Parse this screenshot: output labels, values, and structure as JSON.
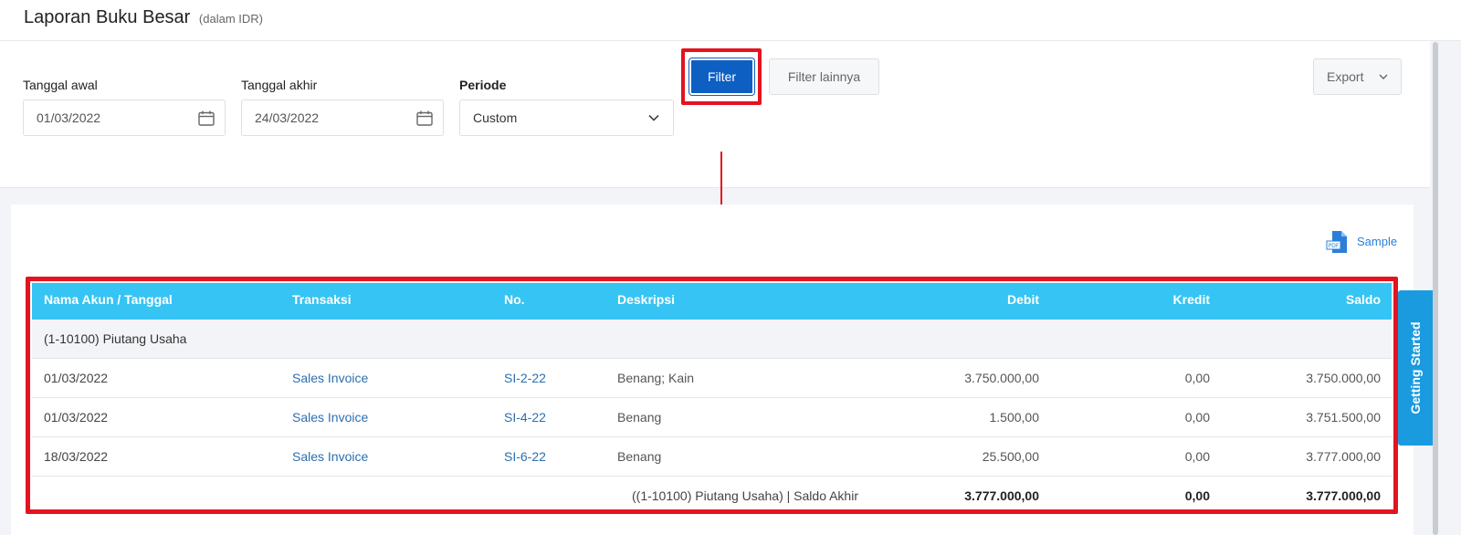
{
  "header": {
    "title": "Laporan Buku Besar",
    "subtitle": "(dalam IDR)"
  },
  "filters": {
    "start_label": "Tanggal awal",
    "start_value": "01/03/2022",
    "end_label": "Tanggal akhir",
    "end_value": "24/03/2022",
    "period_label": "Periode",
    "period_value": "Custom",
    "filter_button": "Filter",
    "more_filters_button": "Filter lainnya",
    "export_button": "Export"
  },
  "sample_link": "Sample",
  "table": {
    "columns": [
      "Nama Akun / Tanggal",
      "Transaksi",
      "No.",
      "Deskripsi",
      "Debit",
      "Kredit",
      "Saldo"
    ],
    "group": "(1-10100) Piutang Usaha",
    "rows": [
      {
        "date": "01/03/2022",
        "transaction": "Sales Invoice",
        "number": "SI-2-22",
        "description": "Benang; Kain",
        "debit": "3.750.000,00",
        "credit": "0,00",
        "balance": "3.750.000,00"
      },
      {
        "date": "01/03/2022",
        "transaction": "Sales Invoice",
        "number": "SI-4-22",
        "description": "Benang",
        "debit": "1.500,00",
        "credit": "0,00",
        "balance": "3.751.500,00"
      },
      {
        "date": "18/03/2022",
        "transaction": "Sales Invoice",
        "number": "SI-6-22",
        "description": "Benang",
        "debit": "25.500,00",
        "credit": "0,00",
        "balance": "3.777.000,00"
      }
    ],
    "total": {
      "label": "((1-10100) Piutang Usaha) | Saldo Akhir",
      "debit": "3.777.000,00",
      "credit": "0,00",
      "balance": "3.777.000,00"
    }
  },
  "side_tab": "Getting Started",
  "colors": {
    "table_header": "#36c4f4",
    "primary_button": "#0d5fc2",
    "annotation": "#e3141f",
    "link": "#2b6fb0",
    "side_tab": "#1a9be0"
  }
}
